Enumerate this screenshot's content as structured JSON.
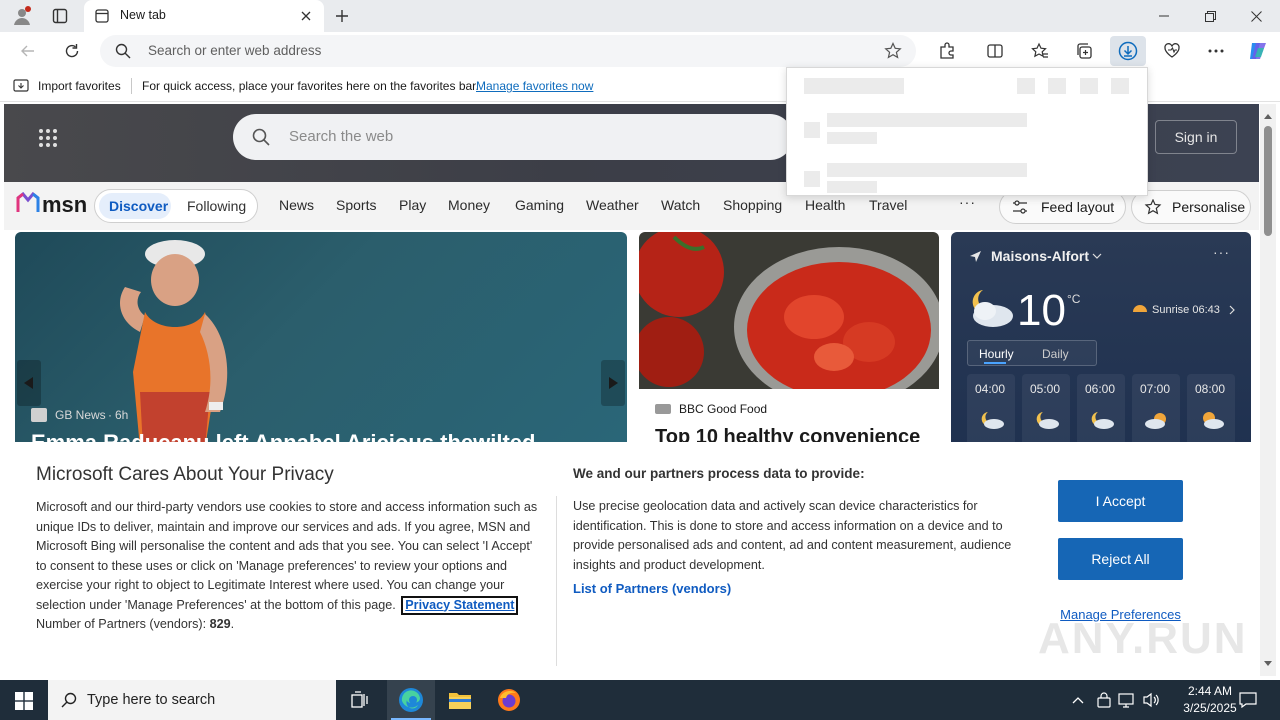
{
  "browser": {
    "tab_title": "New tab",
    "address_placeholder": "Search or enter web address"
  },
  "favorites_bar": {
    "import_label": "Import favorites",
    "hint": "For quick access, place your favorites here on the favorites bar.",
    "manage_link": "Manage favorites now"
  },
  "msn": {
    "search_placeholder": "Search the web",
    "sign_in": "Sign in",
    "logo": "msn",
    "tabs": [
      "Discover",
      "Following"
    ],
    "nav": [
      "News",
      "Sports",
      "Play",
      "Money",
      "Gaming",
      "Weather",
      "Watch",
      "Shopping",
      "Health",
      "Travel"
    ],
    "more": "···",
    "feed_layout": "Feed layout",
    "personalise": "Personalise",
    "main_card": {
      "source": "GB News",
      "age": "6h",
      "headline": "Emma Raducanu left Annabel Aricious thewilted"
    },
    "food_card": {
      "source": "BBC Good Food",
      "headline": "Top 10 healthy convenience"
    },
    "weather": {
      "location": "Maisons-Alfort",
      "temp": "10",
      "unit": "°C",
      "sunrise": "Sunrise 06:43",
      "tab_hourly": "Hourly",
      "tab_daily": "Daily",
      "hours": [
        "04:00",
        "05:00",
        "06:00",
        "07:00",
        "08:00"
      ]
    }
  },
  "consent": {
    "title": "Microsoft Cares About Your Privacy",
    "body": "Microsoft and our third-party vendors use cookies to store and access information such as unique IDs to deliver, maintain and improve our services and ads. If you agree, MSN and Microsoft Bing will personalise the content and ads that you see. You can select 'I Accept' to consent to these uses or click on 'Manage preferences' to review your options and exercise your right to object to Legitimate Interest where used.  You can change your selection under 'Manage Preferences' at the bottom of this page.",
    "privacy_link": "Privacy Statement",
    "partners_label": "Number of Partners (vendors):",
    "partners_count": "829",
    "partners_period": ".",
    "right_title": "We and our partners process data to provide:",
    "right_body": "Use precise geolocation data and actively scan device characteristics for identification. This is done to store and access information on a device and to provide personalised ads and content, ad and content measurement, audience insights and product development.",
    "vendors_link": "List of Partners (vendors)",
    "accept": "I Accept",
    "reject": "Reject All",
    "manage": "Manage Preferences"
  },
  "watermark": "ANY.RUN",
  "taskbar": {
    "search_placeholder": "Type here to search",
    "time": "2:44 AM",
    "date": "3/25/2025"
  },
  "colors": {
    "accent": "#1666b5",
    "taskbar": "#1f2d3a",
    "tab_strip": "#e9ebee"
  }
}
